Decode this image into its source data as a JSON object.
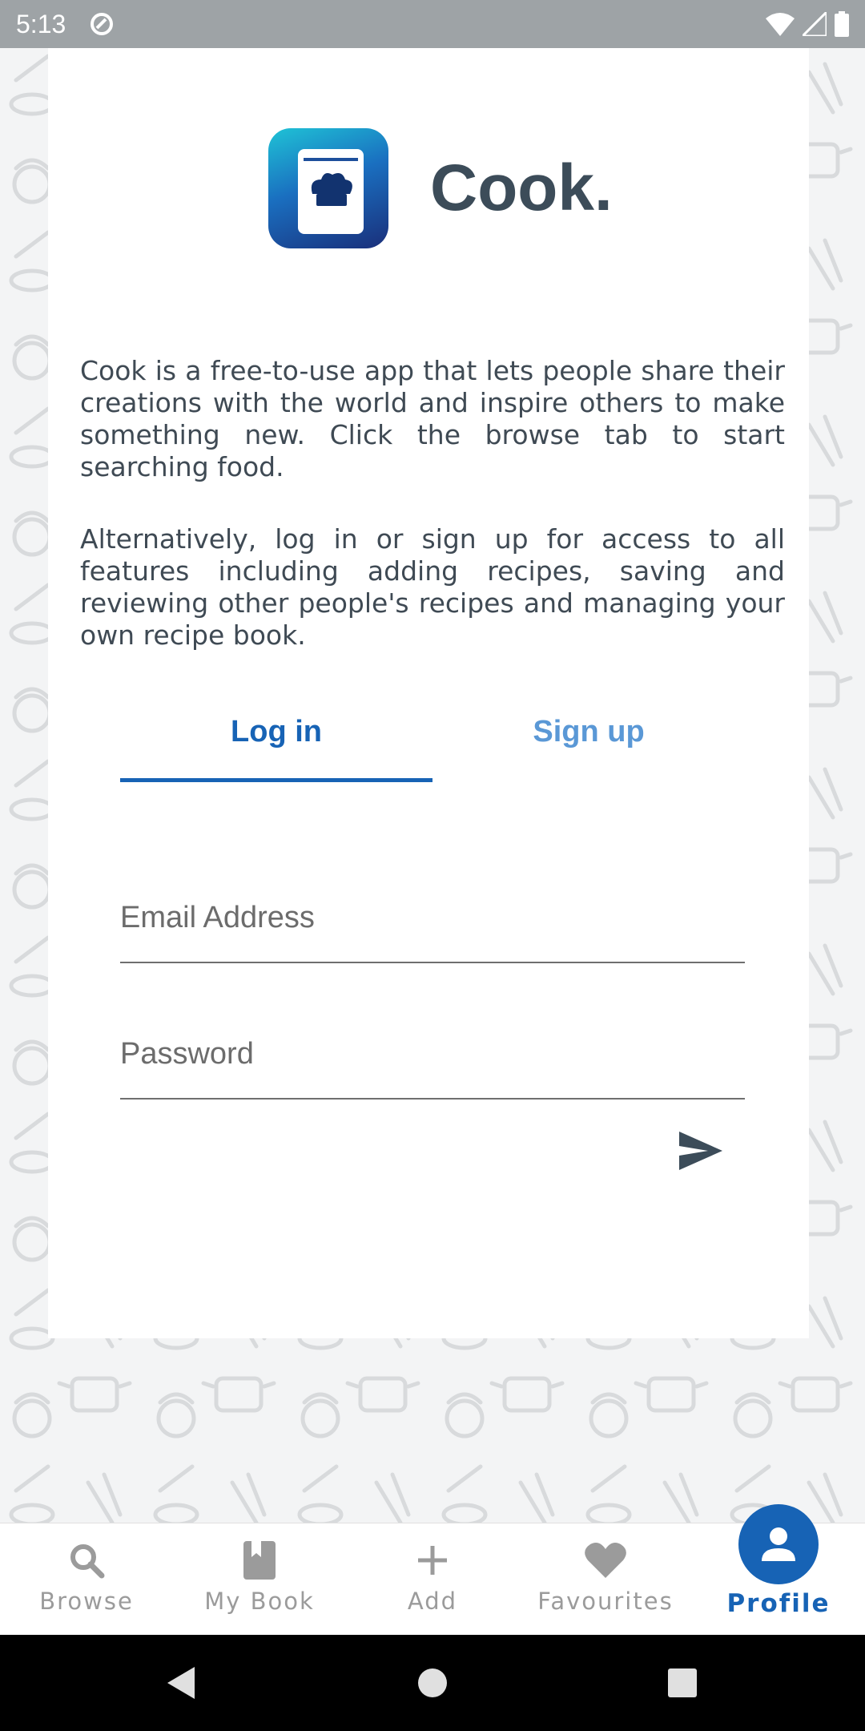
{
  "status_bar": {
    "time": "5:13",
    "icons": [
      "at-sign-icon",
      "wifi-icon",
      "signal-icon",
      "battery-icon"
    ]
  },
  "app": {
    "name": "Cook.",
    "icon": "cookbook-chef-hat-icon"
  },
  "intro": {
    "paragraph1": "Cook is a free-to-use app that lets people share their creations with the world and inspire others to make something new. Click the browse tab to start searching food.",
    "paragraph2": "Alternatively, log in or sign up for access to all features including adding recipes, saving and reviewing other people's recipes and managing your own recipe book."
  },
  "auth_tabs": {
    "login_label": "Log in",
    "signup_label": "Sign up",
    "active": "Log in"
  },
  "form": {
    "email_placeholder": "Email Address",
    "email_value": "",
    "password_placeholder": "Password",
    "password_value": "",
    "submit_icon": "send-icon"
  },
  "bottom_nav": {
    "items": [
      {
        "label": "Browse",
        "icon": "search-icon"
      },
      {
        "label": "My Book",
        "icon": "book-icon"
      },
      {
        "label": "Add",
        "icon": "plus-icon"
      },
      {
        "label": "Favourites",
        "icon": "heart-icon"
      },
      {
        "label": "Profile",
        "icon": "person-icon"
      }
    ],
    "active": "Profile"
  },
  "colors": {
    "accent": "#1763b5",
    "accent_light": "#5a98d6",
    "title": "#3c4c59",
    "nav_inactive": "#9b9b9b"
  }
}
